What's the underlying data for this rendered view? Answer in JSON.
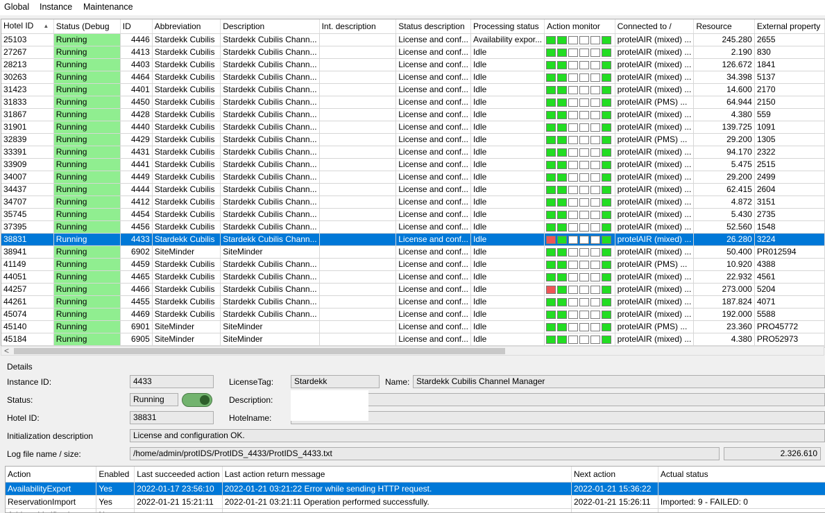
{
  "menu": [
    "Global",
    "Instance",
    "Maintenance"
  ],
  "columns": [
    "Hotel ID",
    "Status (Debug",
    "ID",
    "Abbreviation",
    "Description",
    "Int. description",
    "Status description",
    "Processing status",
    "Action monitor",
    "Connected to /",
    "Resource",
    "External property"
  ],
  "rows": [
    [
      "25103",
      "Running",
      "4446",
      "Stardekk Cubilis",
      "Stardekk Cubilis Chann...",
      "",
      "License and conf...",
      "Availability expor...",
      "ggwwwg",
      "protelAIR (mixed) ...",
      "245.280",
      "2655"
    ],
    [
      "27267",
      "Running",
      "4413",
      "Stardekk Cubilis",
      "Stardekk Cubilis Chann...",
      "",
      "License and conf...",
      "Idle",
      "ggwwwg",
      "protelAIR (mixed) ...",
      "2.190",
      "830"
    ],
    [
      "28213",
      "Running",
      "4403",
      "Stardekk Cubilis",
      "Stardekk Cubilis Chann...",
      "",
      "License and conf...",
      "Idle",
      "ggwwwg",
      "protelAIR (mixed) ...",
      "126.672",
      "1841"
    ],
    [
      "30263",
      "Running",
      "4464",
      "Stardekk Cubilis",
      "Stardekk Cubilis Chann...",
      "",
      "License and conf...",
      "Idle",
      "ggwwwg",
      "protelAIR (mixed) ...",
      "34.398",
      "5137"
    ],
    [
      "31423",
      "Running",
      "4401",
      "Stardekk Cubilis",
      "Stardekk Cubilis Chann...",
      "",
      "License and conf...",
      "Idle",
      "ggwwwg",
      "protelAIR (mixed) ...",
      "14.600",
      "2170"
    ],
    [
      "31833",
      "Running",
      "4450",
      "Stardekk Cubilis",
      "Stardekk Cubilis Chann...",
      "",
      "License and conf...",
      "Idle",
      "ggwwwg",
      "protelAIR (PMS) ...",
      "64.944",
      "2150"
    ],
    [
      "31867",
      "Running",
      "4428",
      "Stardekk Cubilis",
      "Stardekk Cubilis Chann...",
      "",
      "License and conf...",
      "Idle",
      "ggwwwg",
      "protelAIR (mixed) ...",
      "4.380",
      "559"
    ],
    [
      "31901",
      "Running",
      "4440",
      "Stardekk Cubilis",
      "Stardekk Cubilis Chann...",
      "",
      "License and conf...",
      "Idle",
      "ggwwwg",
      "protelAIR (mixed) ...",
      "139.725",
      "1091"
    ],
    [
      "32839",
      "Running",
      "4429",
      "Stardekk Cubilis",
      "Stardekk Cubilis Chann...",
      "",
      "License and conf...",
      "Idle",
      "ggwwwg",
      "protelAIR (PMS) ...",
      "29.200",
      "1305"
    ],
    [
      "33391",
      "Running",
      "4431",
      "Stardekk Cubilis",
      "Stardekk Cubilis Chann...",
      "",
      "License and conf...",
      "Idle",
      "ggwwwg",
      "protelAIR (mixed) ...",
      "94.170",
      "2322"
    ],
    [
      "33909",
      "Running",
      "4441",
      "Stardekk Cubilis",
      "Stardekk Cubilis Chann...",
      "",
      "License and conf...",
      "Idle",
      "ggwwwg",
      "protelAIR (mixed) ...",
      "5.475",
      "2515"
    ],
    [
      "34007",
      "Running",
      "4449",
      "Stardekk Cubilis",
      "Stardekk Cubilis Chann...",
      "",
      "License and conf...",
      "Idle",
      "ggwwwg",
      "protelAIR (mixed) ...",
      "29.200",
      "2499"
    ],
    [
      "34437",
      "Running",
      "4444",
      "Stardekk Cubilis",
      "Stardekk Cubilis Chann...",
      "",
      "License and conf...",
      "Idle",
      "ggwwwg",
      "protelAIR (mixed) ...",
      "62.415",
      "2604"
    ],
    [
      "34707",
      "Running",
      "4412",
      "Stardekk Cubilis",
      "Stardekk Cubilis Chann...",
      "",
      "License and conf...",
      "Idle",
      "ggwwwg",
      "protelAIR (mixed) ...",
      "4.872",
      "3151"
    ],
    [
      "35745",
      "Running",
      "4454",
      "Stardekk Cubilis",
      "Stardekk Cubilis Chann...",
      "",
      "License and conf...",
      "Idle",
      "ggwwwg",
      "protelAIR (mixed) ...",
      "5.430",
      "2735"
    ],
    [
      "37395",
      "Running",
      "4456",
      "Stardekk Cubilis",
      "Stardekk Cubilis Chann...",
      "",
      "License and conf...",
      "Idle",
      "ggwwwg",
      "protelAIR (mixed) ...",
      "52.560",
      "1548"
    ],
    [
      "38831",
      "Running",
      "4433",
      "Stardekk Cubilis",
      "Stardekk Cubilis Chann...",
      "",
      "License and conf...",
      "Idle",
      "rgwwwg",
      "protelAIR (mixed) ...",
      "26.280",
      "3224"
    ],
    [
      "38941",
      "Running",
      "6902",
      "SiteMinder",
      "SiteMinder",
      "",
      "License and conf...",
      "Idle",
      "ggwwwg",
      "protelAIR (mixed) ...",
      "50.400",
      "PR012594"
    ],
    [
      "41149",
      "Running",
      "4459",
      "Stardekk Cubilis",
      "Stardekk Cubilis Chann...",
      "",
      "License and conf...",
      "Idle",
      "ggwwwg",
      "protelAIR (PMS) ...",
      "10.920",
      "4388"
    ],
    [
      "44051",
      "Running",
      "4465",
      "Stardekk Cubilis",
      "Stardekk Cubilis Chann...",
      "",
      "License and conf...",
      "Idle",
      "ggwwwg",
      "protelAIR (mixed) ...",
      "22.932",
      "4561"
    ],
    [
      "44257",
      "Running",
      "4466",
      "Stardekk Cubilis",
      "Stardekk Cubilis Chann...",
      "",
      "License and conf...",
      "Idle",
      "rgwwwg",
      "protelAIR (mixed) ...",
      "273.000",
      "5204"
    ],
    [
      "44261",
      "Running",
      "4455",
      "Stardekk Cubilis",
      "Stardekk Cubilis Chann...",
      "",
      "License and conf...",
      "Idle",
      "ggwwwg",
      "protelAIR (mixed) ...",
      "187.824",
      "4071"
    ],
    [
      "45074",
      "Running",
      "4469",
      "Stardekk Cubilis",
      "Stardekk Cubilis Chann...",
      "",
      "License and conf...",
      "Idle",
      "ggwwwg",
      "protelAIR (mixed) ...",
      "192.000",
      "5588"
    ],
    [
      "45140",
      "Running",
      "6901",
      "SiteMinder",
      "SiteMinder",
      "",
      "License and conf...",
      "Idle",
      "ggwwwg",
      "protelAIR (PMS) ...",
      "23.360",
      "PRO45772"
    ],
    [
      "45184",
      "Running",
      "6905",
      "SiteMinder",
      "SiteMinder",
      "",
      "License and conf...",
      "Idle",
      "ggwwwg",
      "protelAIR (mixed) ...",
      "4.380",
      "PRO52973"
    ]
  ],
  "selected_row": 16,
  "colors": {
    "running": "#90ee90",
    "selection": "#0078d7",
    "monitor_green": "#22dd22",
    "monitor_red": "#ee5555"
  },
  "details": {
    "title": "Details",
    "instance_id_label": "Instance ID:",
    "instance_id": "4433",
    "license_tag_label": "LicenseTag:",
    "license_tag": "Stardekk",
    "name_label": "Name:",
    "name": "Stardekk Cubilis Channel Manager",
    "status_label": "Status:",
    "status": "Running",
    "description_label": "Description:",
    "hotel_id_label": "Hotel ID:",
    "hotel_id": "38831",
    "hotelname_label": "Hotelname:",
    "init_desc_label": "Initialization description",
    "init_desc": "License and configuration OK.",
    "log_label": "Log file name / size:",
    "log_file": "/home/admin/protIDS/ProtIDS_4433/ProtIDS_4433.txt",
    "log_size": "2.326.610"
  },
  "actions": {
    "columns": [
      "Action",
      "Enabled",
      "Last succeeded action",
      "Last action return message",
      "Next action",
      "Actual status"
    ],
    "rows": [
      [
        "AvailabilityExport",
        "Yes",
        "2022-01-17 23:56:10",
        "2022-01-21 03:21:22 Error while sending HTTP request.",
        "2022-01-21 15:36:22",
        ""
      ],
      [
        "ReservationImport",
        "Yes",
        "2022-01-21 15:21:11",
        "2022-01-21 03:21:11 Operation performed successfully.",
        "2022-01-21 15:26:11",
        "Imported: 9 - FAILED: 0"
      ],
      [
        "AddressVerification",
        "No",
        "",
        "",
        "",
        ""
      ]
    ],
    "selected_row": 0
  }
}
